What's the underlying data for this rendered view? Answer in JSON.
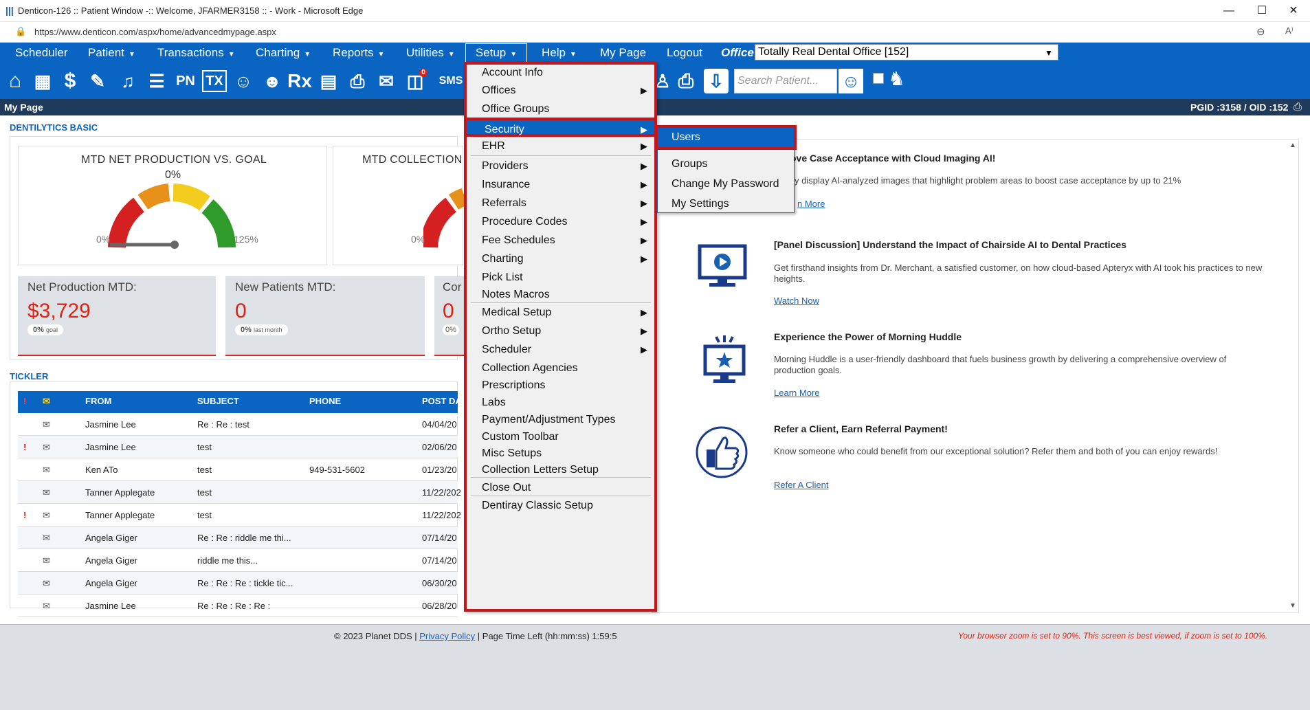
{
  "window": {
    "title": "Denticon-126 :: Patient Window -:: Welcome, JFARMER3158 :: - Work - Microsoft Edge",
    "minimize": "—",
    "maximize": "☐",
    "close": "✕"
  },
  "address": {
    "url": "https://www.denticon.com/aspx/home/advancedmypage.aspx"
  },
  "menubar": {
    "items": [
      {
        "label": "Scheduler",
        "caret": ""
      },
      {
        "label": "Patient",
        "caret": "▼"
      },
      {
        "label": "Transactions",
        "caret": "▼"
      },
      {
        "label": "Charting",
        "caret": "▼"
      },
      {
        "label": "Reports",
        "caret": "▼"
      },
      {
        "label": "Utilities",
        "caret": "▼"
      },
      {
        "label": "Setup",
        "caret": "▼"
      },
      {
        "label": "Help",
        "caret": "▼"
      },
      {
        "label": "My Page",
        "caret": ""
      },
      {
        "label": "Logout",
        "caret": ""
      }
    ],
    "office_label": "Office",
    "office_value": "Totally Real Dental Office [152]"
  },
  "toolbar": {
    "search_placeholder": "Search Patient...",
    "sms_label": "SMS",
    "pn_label": "PN",
    "tx_label": "TX",
    "rx_label": "Rx",
    "badge": "0"
  },
  "breadcrumb": {
    "page_title": "My Page",
    "ids": "PGID :3158  /  OID :152"
  },
  "dentilytics": {
    "heading": "DENTILYTICS BASIC",
    "gauge1": {
      "title": "MTD NET PRODUCTION VS. GOAL",
      "value": "0%",
      "min": "0%",
      "max": "125%"
    },
    "gauge2": {
      "title": "MTD COLLECTION",
      "min": "0%"
    },
    "kpis": [
      {
        "title": "Net Production MTD:",
        "value": "$3,729",
        "pill_pct": "0%",
        "pill_text": "goal"
      },
      {
        "title": "New Patients MTD:",
        "value": "0",
        "pill_pct": "0%",
        "pill_text": "last month"
      },
      {
        "title": "Cor",
        "value": "0",
        "pill_pct": "0%",
        "pill_text": ""
      }
    ]
  },
  "tickler": {
    "heading": "TICKLER",
    "flag_col": "!",
    "columns": [
      "FROM",
      "SUBJECT",
      "PHONE",
      "POST DA"
    ],
    "rows": [
      {
        "flag": "",
        "from": "Jasmine Lee",
        "subject": "Re : Re : test",
        "phone": "",
        "date": "04/04/20"
      },
      {
        "flag": "!",
        "from": "Jasmine Lee",
        "subject": "test",
        "phone": "",
        "date": "02/06/20"
      },
      {
        "flag": "",
        "from": "Ken ATo",
        "subject": "test",
        "phone": "949-531-5602",
        "date": "01/23/20"
      },
      {
        "flag": "",
        "from": "Tanner Applegate",
        "subject": "test",
        "phone": "",
        "date": "11/22/202"
      },
      {
        "flag": "!",
        "from": "Tanner Applegate",
        "subject": "test",
        "phone": "",
        "date": "11/22/202"
      },
      {
        "flag": "",
        "from": "Angela Giger",
        "subject": "Re : Re : riddle me thi...",
        "phone": "",
        "date": "07/14/20"
      },
      {
        "flag": "",
        "from": "Angela Giger",
        "subject": "riddle me this...",
        "phone": "",
        "date": "07/14/20"
      },
      {
        "flag": "",
        "from": "Angela Giger",
        "subject": "Re : Re : Re : tickle tic...",
        "phone": "",
        "date": "06/30/20"
      },
      {
        "flag": "",
        "from": "Jasmine Lee",
        "subject": "Re : Re : Re : Re :",
        "phone": "",
        "date": "06/28/20"
      }
    ]
  },
  "news": [
    {
      "title": "ove Case Acceptance with Cloud Imaging AI!",
      "body": "y display AI-analyzed images that highlight problem areas to boost case acceptance by up to 21%",
      "link": "n More"
    },
    {
      "title": "[Panel Discussion] Understand the Impact of Chairside AI to Dental Practices",
      "body": "Get firsthand insights from Dr. Merchant, a satisfied customer, on how cloud-based Apteryx with AI took his practices to new heights.",
      "link": "Watch Now"
    },
    {
      "title": "Experience the Power of Morning Huddle",
      "body": "Morning Huddle is a user-friendly dashboard that fuels business growth by delivering a comprehensive overview of production goals.",
      "link": "Learn More"
    },
    {
      "title": "Refer a Client, Earn Referral Payment!",
      "body": "Know someone who could benefit from our exceptional solution? Refer them and both of you can enjoy rewards!",
      "link": "Refer A Client"
    }
  ],
  "setup_menu": {
    "items": [
      {
        "label": "Account Info",
        "arrow": ""
      },
      {
        "label": "Offices",
        "arrow": "▶"
      },
      {
        "label": "Office Groups",
        "arrow": ""
      },
      {
        "label": "Security",
        "arrow": "▶"
      },
      {
        "label": "EHR",
        "arrow": "▶"
      },
      {
        "label": "Providers",
        "arrow": "▶"
      },
      {
        "label": "Insurance",
        "arrow": "▶"
      },
      {
        "label": "Referrals",
        "arrow": "▶"
      },
      {
        "label": "Procedure Codes",
        "arrow": "▶"
      },
      {
        "label": "Fee Schedules",
        "arrow": "▶"
      },
      {
        "label": "Charting",
        "arrow": "▶"
      },
      {
        "label": "Pick List",
        "arrow": ""
      },
      {
        "label": "Notes Macros",
        "arrow": ""
      },
      {
        "label": "Medical Setup",
        "arrow": "▶"
      },
      {
        "label": "Ortho Setup",
        "arrow": "▶"
      },
      {
        "label": "Scheduler",
        "arrow": "▶"
      },
      {
        "label": "Collection Agencies",
        "arrow": ""
      },
      {
        "label": "Prescriptions",
        "arrow": ""
      },
      {
        "label": "Labs",
        "arrow": ""
      },
      {
        "label": "Payment/Adjustment Types",
        "arrow": ""
      },
      {
        "label": "Custom Toolbar",
        "arrow": ""
      },
      {
        "label": "Misc Setups",
        "arrow": ""
      },
      {
        "label": "Collection Letters Setup",
        "arrow": ""
      },
      {
        "label": "Close Out",
        "arrow": ""
      },
      {
        "label": "Dentiray Classic Setup",
        "arrow": ""
      }
    ]
  },
  "security_submenu": {
    "items": [
      "Users",
      "Groups",
      "Change My Password",
      "My Settings"
    ]
  },
  "footer": {
    "copyright": "© 2023 Planet DDS | ",
    "privacy": "Privacy Policy",
    "page_time": " | Page Time Left (hh:mm:ss) 1:59:5",
    "zoom_warning": "Your browser zoom is set to 90%. This screen is best viewed, if zoom is set to 100%."
  },
  "colors": {
    "brand_blue": "#0a64c2",
    "highlight_red": "#c4151c",
    "kpi_red": "#d21"
  }
}
